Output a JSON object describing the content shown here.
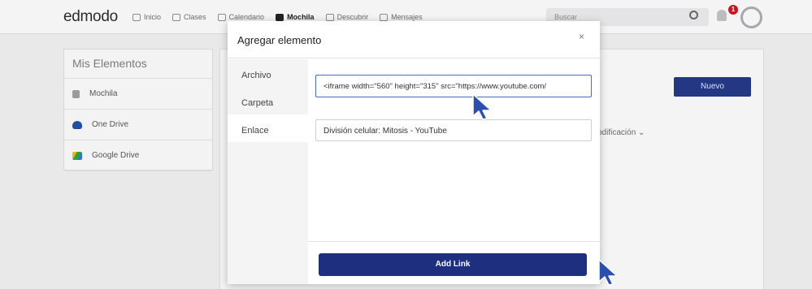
{
  "topbar": {
    "logo": "edmodo",
    "nav": [
      {
        "label": "Inicio",
        "icon": "home-icon"
      },
      {
        "label": "Clases",
        "icon": "classes-icon"
      },
      {
        "label": "Calendario",
        "icon": "calendar-icon"
      },
      {
        "label": "Mochila",
        "icon": "backpack-icon",
        "active": true
      },
      {
        "label": "Descubrir",
        "icon": "discover-icon"
      },
      {
        "label": "Mensajes",
        "icon": "messages-icon"
      }
    ],
    "search_placeholder": "Buscar",
    "notification_count": "1"
  },
  "sidebar": {
    "title": "Mis Elementos",
    "items": [
      {
        "label": "Mochila",
        "icon": "backpack-icon",
        "color": "#9b9b9b"
      },
      {
        "label": "One Drive",
        "icon": "onedrive-icon",
        "color": "#1f4fa5"
      },
      {
        "label": "Google Drive",
        "icon": "google-drive-icon",
        "color": "#2f9e44"
      }
    ]
  },
  "main": {
    "new_button": "Nuevo",
    "sort_label": "odificación ⌄",
    "bottom_text": ""
  },
  "modal": {
    "title": "Agregar elemento",
    "close": "×",
    "tabs": [
      {
        "label": "Archivo"
      },
      {
        "label": "Carpeta"
      },
      {
        "label": "Enlace",
        "active": true
      }
    ],
    "url_value": "<iframe width=\"560\" height=\"315\" src=\"https://www.youtube.com/",
    "title_value": "División celular: Mitosis - YouTube",
    "submit_label": "Add Link"
  },
  "colors": {
    "accent": "#1e2f80",
    "cursor": "#2a4fb0"
  }
}
